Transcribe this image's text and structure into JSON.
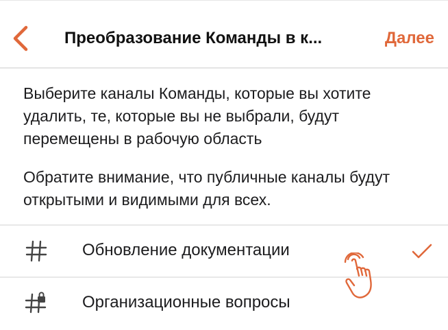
{
  "header": {
    "back_icon": "chevron-left-icon",
    "title": "Преобразование Команды в к...",
    "next_label": "Далее",
    "accent_color": "#e0683a"
  },
  "description": {
    "paragraph1": "Выберите каналы Команды, которые вы хотите удалить, те, которые вы не выбрали, будут перемещены в рабочую область",
    "paragraph2": "Обратите внимание, что публичные каналы будут открытыми и видимыми для всех."
  },
  "channels": [
    {
      "name": "Обновление документации",
      "icon": "hash-icon",
      "selected": true
    },
    {
      "name": "Организационные вопросы",
      "icon": "hash-lock-icon",
      "selected": false
    }
  ]
}
